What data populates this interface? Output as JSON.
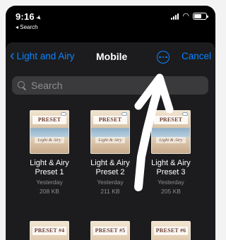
{
  "status_bar": {
    "time": "9:16",
    "location_icon": "location-arrow-icon",
    "back_link": "◂ Search",
    "signal_icon": "cellular-signal-icon",
    "wifi_icon": "wifi-icon",
    "battery_icon": "battery-icon",
    "battery_level": 0.6
  },
  "nav": {
    "back_label": "Light and Airy",
    "title": "Mobile",
    "more_icon": "ellipsis-circle-icon",
    "cancel_label": "Cancel"
  },
  "search": {
    "placeholder": "Search",
    "icon": "magnifier-icon"
  },
  "files": [
    {
      "banner": "PRESET",
      "script": "Light & Airy",
      "name_line1": "Light & Airy",
      "name_line2": "Preset 1",
      "date": "Yesterday",
      "size": "208 KB"
    },
    {
      "banner": "PRESET",
      "script": "Light & Airy",
      "name_line1": "Light & Airy",
      "name_line2": "Preset 2",
      "date": "Yesterday",
      "size": "211 KB"
    },
    {
      "banner": "PRESET",
      "script": "Light & Airy",
      "name_line1": "Light & Airy",
      "name_line2": "Preset 3",
      "date": "Yesterday",
      "size": "205 KB"
    }
  ],
  "files_lower": [
    {
      "banner": "PRESET #4"
    },
    {
      "banner": "PRESET #5"
    },
    {
      "banner": "PRESET #6"
    }
  ],
  "colors": {
    "accent": "#0a84ff",
    "background": "#000000",
    "sheet": "#1c1c1e",
    "secondary_text": "#8e8e93"
  },
  "annotation_arrow_icon": "hand-drawn-arrow-icon"
}
